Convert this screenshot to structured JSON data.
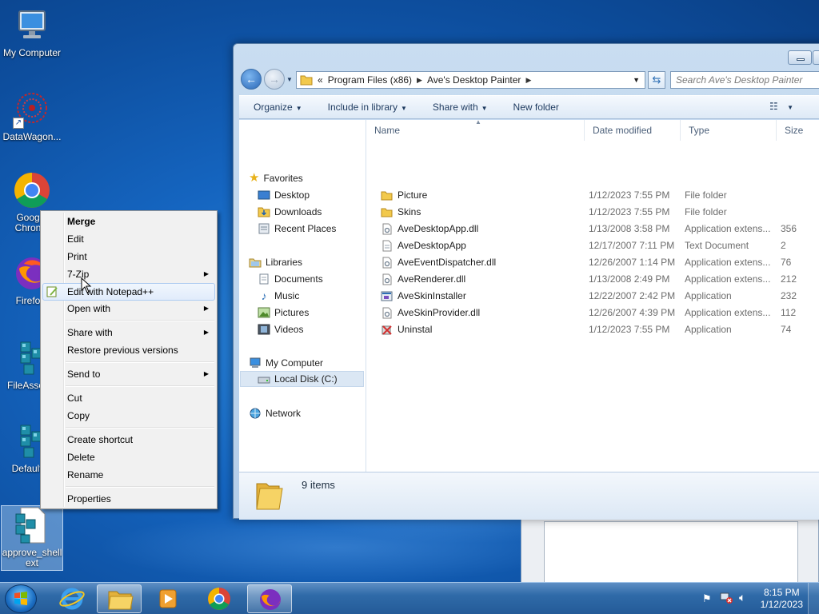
{
  "desktop": {
    "icons": [
      {
        "label": "My Computer"
      },
      {
        "label": "DataWagon..."
      },
      {
        "label": "Goog... Chron..."
      },
      {
        "label": "Firefo..."
      },
      {
        "label": "FileAssoc..."
      },
      {
        "label": "Defaultl..."
      },
      {
        "label": "approve_shell ext"
      }
    ]
  },
  "explorer": {
    "breadcrumb": {
      "overflow": "«",
      "parts": [
        "Program Files (x86)",
        "Ave's Desktop Painter"
      ]
    },
    "search_placeholder": "Search Ave's Desktop Painter",
    "toolbar": {
      "organize": "Organize",
      "include": "Include in library",
      "share": "Share with",
      "new_folder": "New folder"
    },
    "nav": {
      "favorites": "Favorites",
      "desktop": "Desktop",
      "downloads": "Downloads",
      "recent": "Recent Places",
      "libraries": "Libraries",
      "documents": "Documents",
      "music": "Music",
      "pictures": "Pictures",
      "videos": "Videos",
      "computer": "My Computer",
      "local_disk": "Local Disk (C:)",
      "network": "Network"
    },
    "columns": {
      "name": "Name",
      "date": "Date modified",
      "type": "Type",
      "size": "Size"
    },
    "files": [
      {
        "name": "Picture",
        "date": "1/12/2023 7:55 PM",
        "type": "File folder",
        "size": "",
        "icon": "folder"
      },
      {
        "name": "Skins",
        "date": "1/12/2023 7:55 PM",
        "type": "File folder",
        "size": "",
        "icon": "folder"
      },
      {
        "name": "AveDesktopApp.dll",
        "date": "1/13/2008 3:58 PM",
        "type": "Application extens...",
        "size": "356",
        "icon": "dll"
      },
      {
        "name": "AveDesktopApp",
        "date": "12/17/2007 7:11 PM",
        "type": "Text Document",
        "size": "2",
        "icon": "text"
      },
      {
        "name": "AveEventDispatcher.dll",
        "date": "12/26/2007 1:14 PM",
        "type": "Application extens...",
        "size": "76",
        "icon": "dll"
      },
      {
        "name": "AveRenderer.dll",
        "date": "1/13/2008 2:49 PM",
        "type": "Application extens...",
        "size": "212",
        "icon": "dll"
      },
      {
        "name": "AveSkinInstaller",
        "date": "12/22/2007 2:42 PM",
        "type": "Application",
        "size": "232",
        "icon": "app"
      },
      {
        "name": "AveSkinProvider.dll",
        "date": "12/26/2007 4:39 PM",
        "type": "Application extens...",
        "size": "112",
        "icon": "dll"
      },
      {
        "name": "Uninstal",
        "date": "1/12/2023 7:55 PM",
        "type": "Application",
        "size": "74",
        "icon": "uninstall"
      }
    ],
    "status": "9 items"
  },
  "context_menu": {
    "merge": "Merge",
    "edit": "Edit",
    "print": "Print",
    "seven_zip": "7-Zip",
    "notepadpp": "Edit with Notepad++",
    "open_with": "Open with",
    "share_with": "Share with",
    "restore": "Restore previous versions",
    "send_to": "Send to",
    "cut": "Cut",
    "copy": "Copy",
    "create_shortcut": "Create shortcut",
    "delete": "Delete",
    "rename": "Rename",
    "properties": "Properties"
  },
  "taskbar": {
    "time": "8:15 PM",
    "date": "1/12/2023"
  },
  "colors": {
    "accent": "#2f6aa8",
    "folder": "#f2c94c",
    "selection": "#dbe7f4"
  }
}
